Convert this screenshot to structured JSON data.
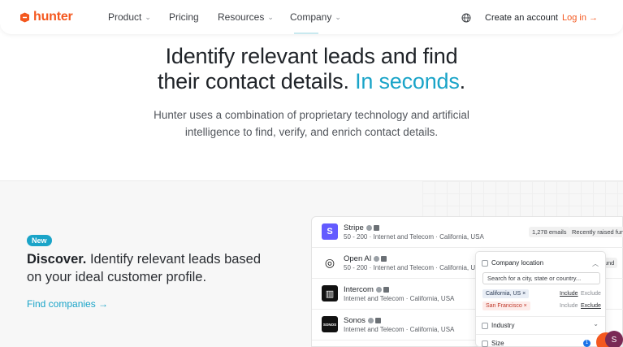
{
  "header": {
    "logo_text": "hunter",
    "brand_color": "#f4581f",
    "nav": [
      {
        "label": "Product",
        "has_dropdown": true
      },
      {
        "label": "Pricing",
        "has_dropdown": false
      },
      {
        "label": "Resources",
        "has_dropdown": true
      },
      {
        "label": "Company",
        "has_dropdown": true
      }
    ],
    "chevron": "⌄",
    "create_account": "Create an account",
    "login": "Log in →"
  },
  "hero": {
    "title_line1": "Identify relevant leads and find",
    "title_line2_prefix": "their contact details. ",
    "title_line2_accent": "In seconds",
    "title_line2_suffix": ".",
    "accent_color": "#1aa4c8",
    "subtitle_line1": "Hunter uses a combination of proprietary technology and artificial",
    "subtitle_line2": "intelligence to find, verify, and enrich contact details."
  },
  "discover": {
    "badge": "New",
    "heading_bold": "Discover.",
    "heading_rest": " Identify relevant leads based on your ideal customer profile.",
    "link": "Find companies →"
  },
  "companies": [
    {
      "name": "Stripe",
      "logo_letter": "S",
      "logo_color": "#635bff",
      "meta": "50 - 200  ·  Internet and Telecom  ·  California, USA"
    },
    {
      "name": "Open AI",
      "logo_letter": "◎",
      "logo_color": "#ffffff",
      "meta": "50 - 200  ·  Internet and Telecom  ·  California, USA"
    },
    {
      "name": "Intercom",
      "logo_letter": "▥",
      "logo_color": "#111111",
      "meta": "Internet and Telecom  ·  California, USA"
    },
    {
      "name": "Sonos",
      "logo_letter": "SONOS",
      "logo_color": "#111111",
      "meta": "Internet and Telecom  ·  California, USA"
    }
  ],
  "chips": {
    "emails": "1,278 emails",
    "funding": "Recently raised fund",
    "funding_short": "l fund"
  },
  "filter": {
    "title": "Company location",
    "caret": "︿",
    "placeholder": "Search for a city, state or country...",
    "tags": [
      {
        "label": "California, US ×",
        "include": "Include",
        "exclude": "Exclude"
      },
      {
        "label": "San Francisco ×",
        "include": "Include",
        "exclude": "Exclude"
      }
    ],
    "industry": "Industry",
    "size": "Size",
    "size_count": "1",
    "industry_caret": "⌄"
  },
  "avatar_letter": "S"
}
